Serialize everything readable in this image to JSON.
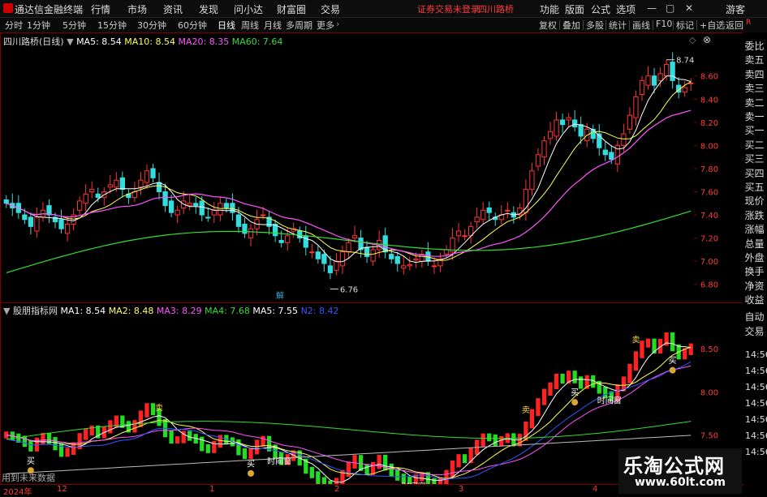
{
  "app": {
    "title": "通达信金融终端",
    "menu": [
      "行情",
      "市场",
      "资讯",
      "发现",
      "问小达",
      "财富圈",
      "交易"
    ],
    "alert": "证券交易未登录",
    "stock": "四川路桥",
    "right_menu": [
      "功能",
      "版面",
      "公式",
      "选项"
    ],
    "user": "游客"
  },
  "toolbar": {
    "periods": [
      "分时",
      "1分钟",
      "5分钟",
      "15分钟",
      "30分钟",
      "60分钟",
      "日线",
      "周线",
      "月线",
      "多周期",
      "更多"
    ],
    "active_period": "日线",
    "tools": [
      "复权",
      "叠加",
      "多股",
      "统计",
      "画线",
      "F10",
      "标记",
      "+自选",
      "返回"
    ]
  },
  "main_panel": {
    "title": "四川路桥(日线)",
    "ma": [
      {
        "label": "MA5: 8.54",
        "color": "#ffffff"
      },
      {
        "label": "MA10: 8.54",
        "color": "#ffff55"
      },
      {
        "label": "MA20: 8.35",
        "color": "#ff55ff"
      },
      {
        "label": "MA60: 7.64",
        "color": "#33dd33"
      }
    ],
    "high_label": "8.74",
    "low_label": "6.76",
    "marker": "解"
  },
  "sub_panel": {
    "title": "股朋指标网",
    "ma": [
      {
        "label": "MA1: 8.54",
        "color": "#ffffff"
      },
      {
        "label": "MA2: 8.48",
        "color": "#ffff55"
      },
      {
        "label": "MA3: 8.29",
        "color": "#ff55ff"
      },
      {
        "label": "MA4: 7.68",
        "color": "#33dd33"
      },
      {
        "label": "MA5: 7.55",
        "color": "#ffffff"
      },
      {
        "label": "N2: 8.42",
        "color": "#3355ff"
      }
    ],
    "signal_buy": "买",
    "signal_sell": "卖",
    "time_window": "时间窗",
    "footer_note": "用到未来数据"
  },
  "side_labels": [
    "委比",
    "卖五",
    "卖四",
    "卖三",
    "卖二",
    "卖一",
    "买一",
    "买二",
    "买三",
    "买四",
    "买五",
    "现价",
    "涨跌",
    "涨幅",
    "总量",
    "外盘",
    "换手",
    "净资",
    "收益"
  ],
  "side_labels2": [
    "自动",
    "交易"
  ],
  "side_times": [
    "14:56",
    "14:56",
    "14:56",
    "14:56",
    "14:56",
    "14:56",
    "14:56"
  ],
  "x_axis": [
    "2024年",
    "12",
    "1",
    "2",
    "3",
    "4"
  ],
  "watermark": {
    "line1": "乐淘公式网",
    "line2": "www.60lt.com"
  },
  "chart_data": [
    {
      "type": "candlestick",
      "title": "四川路桥(日线)",
      "ylim": [
        6.7,
        8.85
      ],
      "y_ticks": [
        6.8,
        7.0,
        7.2,
        7.4,
        7.6,
        7.8,
        8.0,
        8.2,
        8.4,
        8.6
      ],
      "close": [
        7.5,
        7.46,
        7.42,
        7.36,
        7.3,
        7.38,
        7.44,
        7.4,
        7.34,
        7.28,
        7.32,
        7.4,
        7.52,
        7.58,
        7.62,
        7.55,
        7.6,
        7.66,
        7.7,
        7.62,
        7.55,
        7.6,
        7.7,
        7.78,
        7.72,
        7.6,
        7.48,
        7.42,
        7.44,
        7.52,
        7.5,
        7.48,
        7.4,
        7.38,
        7.44,
        7.5,
        7.46,
        7.42,
        7.3,
        7.24,
        7.28,
        7.36,
        7.4,
        7.3,
        7.22,
        7.16,
        7.22,
        7.28,
        7.2,
        7.12,
        7.08,
        7.02,
        6.98,
        6.9,
        7.0,
        7.08,
        7.16,
        7.22,
        7.1,
        7.04,
        7.1,
        7.18,
        7.08,
        7.02,
        6.98,
        6.96,
        6.97,
        7.02,
        7.06,
        7.0,
        6.96,
        7.02,
        7.1,
        7.2,
        7.26,
        7.22,
        7.3,
        7.38,
        7.44,
        7.42,
        7.36,
        7.4,
        7.44,
        7.38,
        7.46,
        7.62,
        7.78,
        7.92,
        8.04,
        8.12,
        8.22,
        8.18,
        8.24,
        8.16,
        8.08,
        8.14,
        8.06,
        7.98,
        7.92,
        7.88,
        8.0,
        8.1,
        8.26,
        8.42,
        8.56,
        8.6,
        8.52,
        8.62,
        8.7,
        8.56,
        8.46,
        8.5,
        8.54
      ],
      "ma5_last": 8.54,
      "ma10_last": 8.54,
      "ma20_last": 8.35,
      "ma60_last": 7.64,
      "high": 8.74,
      "low": 6.76
    },
    {
      "type": "bar",
      "title": "股朋指标网",
      "ylim": [
        6.95,
        8.85
      ],
      "y_ticks": [
        7.0,
        7.5,
        8.0,
        8.5
      ],
      "signals": [
        "买",
        "卖",
        "时间窗"
      ]
    }
  ]
}
